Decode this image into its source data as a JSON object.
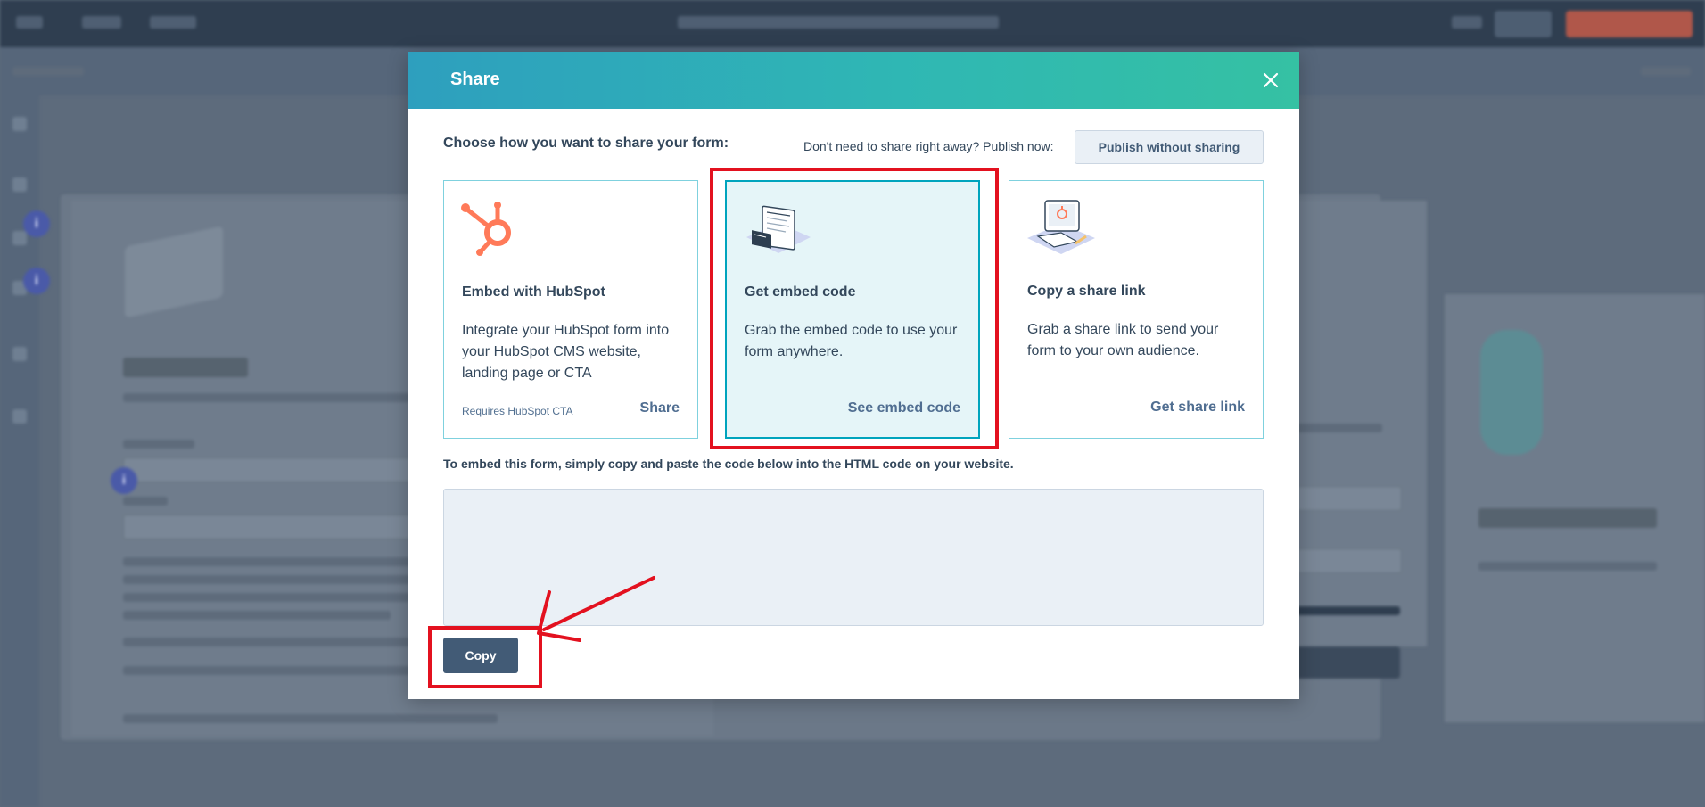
{
  "background": {
    "info_badges": [
      "i",
      "i",
      "i"
    ]
  },
  "modal": {
    "title": "Share",
    "close_icon": "close-icon",
    "choose_label": "Choose how you want to share your form:",
    "publish_hint": "Don't need to share right away? Publish now:",
    "publish_button": "Publish without sharing",
    "options": [
      {
        "icon": "hubspot-sprocket-icon",
        "title": "Embed with HubSpot",
        "description": "Integrate your HubSpot form into your HubSpot CMS website, landing page or CTA",
        "requirement": "Requires HubSpot CTA",
        "action": "Share",
        "selected": false
      },
      {
        "icon": "embed-code-icon",
        "title": "Get embed code",
        "description": "Grab the embed code to use your form anywhere.",
        "action": "See embed code",
        "selected": true
      },
      {
        "icon": "share-link-icon",
        "title": "Copy a share link",
        "description": "Grab a share link to send your form to your own audience.",
        "action": "Get share link",
        "selected": false
      }
    ],
    "embed_instructions": "To embed this form, simply copy and paste the code below into the HTML code on your website.",
    "embed_code": "",
    "copy_button": "Copy"
  },
  "colors": {
    "header_gradient_start": "#2e9fbe",
    "header_gradient_end": "#35c1a3",
    "selected_border": "#00a4bd",
    "copy_button": "#425b76",
    "annotation": "#e3111f",
    "hubspot_orange": "#ff7a59"
  }
}
